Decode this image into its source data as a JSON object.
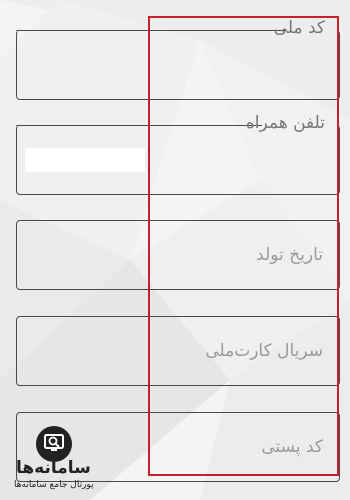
{
  "form": {
    "national_code": {
      "label": "کد ملی"
    },
    "mobile": {
      "label": "تلفن همراه"
    },
    "birth_date": {
      "placeholder": "تاریخ تولد"
    },
    "card_serial": {
      "placeholder": "سریال کارت‌ملی"
    },
    "postal_code": {
      "placeholder": "کد پستی"
    }
  },
  "watermark": {
    "title": "سامانه‌ها",
    "subtitle": "پورتال جامع سامانه‌ها"
  },
  "colors": {
    "border": "#4a4a4a",
    "highlight": "#c8202a",
    "label": "#777777"
  },
  "icons": {
    "logo": "magnifier-monitor-icon"
  }
}
